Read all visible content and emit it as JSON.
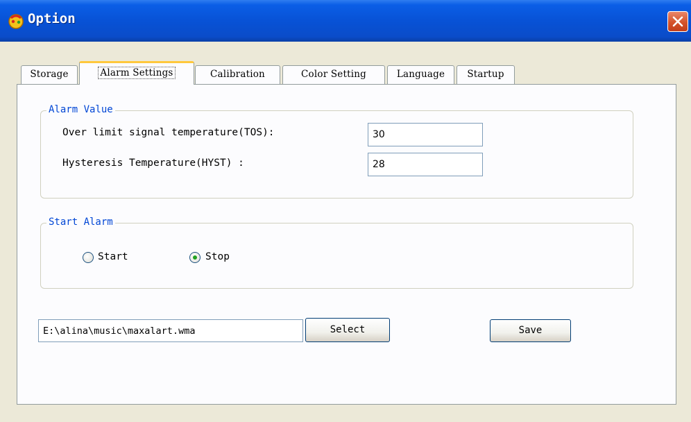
{
  "window": {
    "title": "Option",
    "close_label": "×"
  },
  "tabs": [
    {
      "label": "Storage",
      "active": false
    },
    {
      "label": "Alarm Settings",
      "active": true
    },
    {
      "label": "Calibration",
      "active": false
    },
    {
      "label": "Color Setting",
      "active": false
    },
    {
      "label": "Language",
      "active": false
    },
    {
      "label": "Startup",
      "active": false
    }
  ],
  "alarm_value": {
    "title": "Alarm Value",
    "tos_label": "Over limit signal temperature(TOS):",
    "tos_value": "30",
    "hyst_label": "Hysteresis Temperature(HYST) :",
    "hyst_value": "28"
  },
  "start_alarm": {
    "title": "Start Alarm",
    "options": [
      {
        "label": "Start",
        "selected": false
      },
      {
        "label": "Stop",
        "selected": true
      }
    ]
  },
  "sound_file": {
    "path": "E:\\alina\\music\\maxalart.wma",
    "select_label": "Select"
  },
  "save_label": "Save",
  "colors": {
    "title_bar": "#0852d6",
    "group_title": "#0046d5",
    "active_tab_accent": "#ffc83c",
    "radio_dot": "#21a121"
  }
}
